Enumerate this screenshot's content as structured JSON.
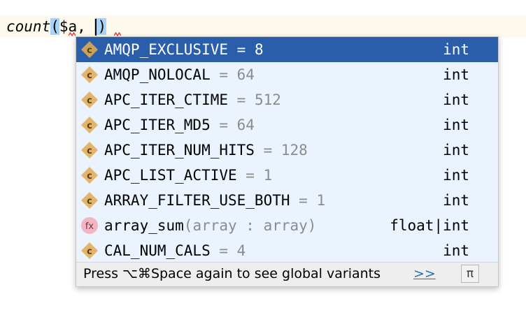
{
  "editor": {
    "function_name": "count",
    "open_paren": "(",
    "argument": "$a, ",
    "close_paren": ")"
  },
  "completion": {
    "items": [
      {
        "icon": "constant-icon",
        "name": "AMQP_EXCLUSIVE",
        "value": " = 8",
        "type": "int",
        "selected": true
      },
      {
        "icon": "constant-icon",
        "name": "AMQP_NOLOCAL",
        "value": " = 64",
        "type": "int"
      },
      {
        "icon": "constant-icon",
        "name": "APC_ITER_CTIME",
        "value": " = 512",
        "type": "int"
      },
      {
        "icon": "constant-icon",
        "name": "APC_ITER_MD5",
        "value": " = 64",
        "type": "int"
      },
      {
        "icon": "constant-icon",
        "name": "APC_ITER_NUM_HITS",
        "value": " = 128",
        "type": "int"
      },
      {
        "icon": "constant-icon",
        "name": "APC_LIST_ACTIVE",
        "value": " = 1",
        "type": "int"
      },
      {
        "icon": "constant-icon",
        "name": "ARRAY_FILTER_USE_BOTH",
        "value": " = 1",
        "type": "int"
      },
      {
        "icon": "function-icon",
        "name": "array_sum",
        "value": "(array : array)",
        "type": "float|int"
      },
      {
        "icon": "constant-icon",
        "name": "CAL_NUM_CALS",
        "value": " = 4",
        "type": "int"
      }
    ],
    "footer": {
      "hint": "Press ⌥⌘Space again to see global variants",
      "more_link": ">>",
      "pi_button": "π"
    }
  },
  "colors": {
    "selection": "#2a5eaa",
    "popup_bg": "#ebf4fe",
    "constant_icon": "#e2b56b",
    "function_icon": "#f3b4c3"
  }
}
